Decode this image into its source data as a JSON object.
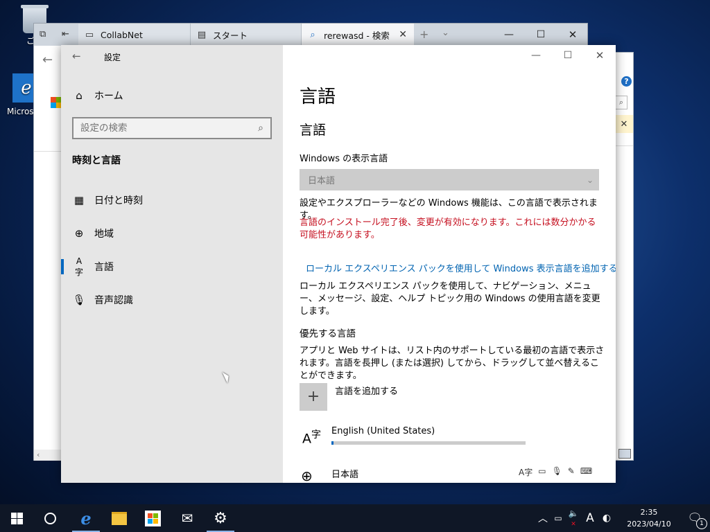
{
  "desktop": {
    "recycle_bin_label": "ごみ",
    "edge_label": "Micros"
  },
  "edge_browser": {
    "tabs": [
      {
        "label": "CollabNet",
        "icon": "page-icon"
      },
      {
        "label": "スタート",
        "icon": "start-page-icon"
      },
      {
        "label": "rerewasd - 検索",
        "icon": "search-icon"
      }
    ]
  },
  "settings": {
    "window_title": "設定",
    "home_label": "ホーム",
    "search_placeholder": "設定の検索",
    "section_title": "時刻と言語",
    "nav_items": [
      {
        "label": "日付と時刻",
        "icon": "calendar-clock-icon"
      },
      {
        "label": "地域",
        "icon": "globe-icon"
      },
      {
        "label": "言語",
        "icon": "language-icon"
      },
      {
        "label": "音声認識",
        "icon": "microphone-icon"
      }
    ],
    "page_title": "言語",
    "subtitle": "言語",
    "display_language_label": "Windows の表示言語",
    "display_language_value": "日本語",
    "display_language_desc": "設定やエクスプローラーなどの Windows 機能は、この言語で表示されます。",
    "warning_text": "言語のインストール完了後、変更が有効になります。これには数分かかる可能性があります。",
    "local_experience_link": "ローカル エクスペリエンス パックを使用して Windows 表示言語を追加する",
    "local_experience_desc": "ローカル エクスペリエンス パックを使用して、ナビゲーション、メニュー、メッセージ、設定、ヘルプ トピック用の Windows の使用言語を変更します。",
    "preferred_title": "優先する言語",
    "preferred_desc": "アプリと Web サイトは、リスト内のサポートしている最初の言語で表示されます。言語を長押し (または選択) してから、ドラッグして並べ替えることができます。",
    "add_language_label": "言語を追加する",
    "languages": [
      {
        "name": "English (United States)",
        "progress": 0.01
      },
      {
        "name": "日本語"
      }
    ]
  },
  "taskbar": {
    "time": "2:35",
    "date": "2023/04/10",
    "ime_label": "A",
    "notification_count": "1"
  },
  "colors": {
    "accent": "#0067c0",
    "warning": "#c50f1f",
    "link": "#0063b1",
    "taskbar": "#0f1726"
  }
}
